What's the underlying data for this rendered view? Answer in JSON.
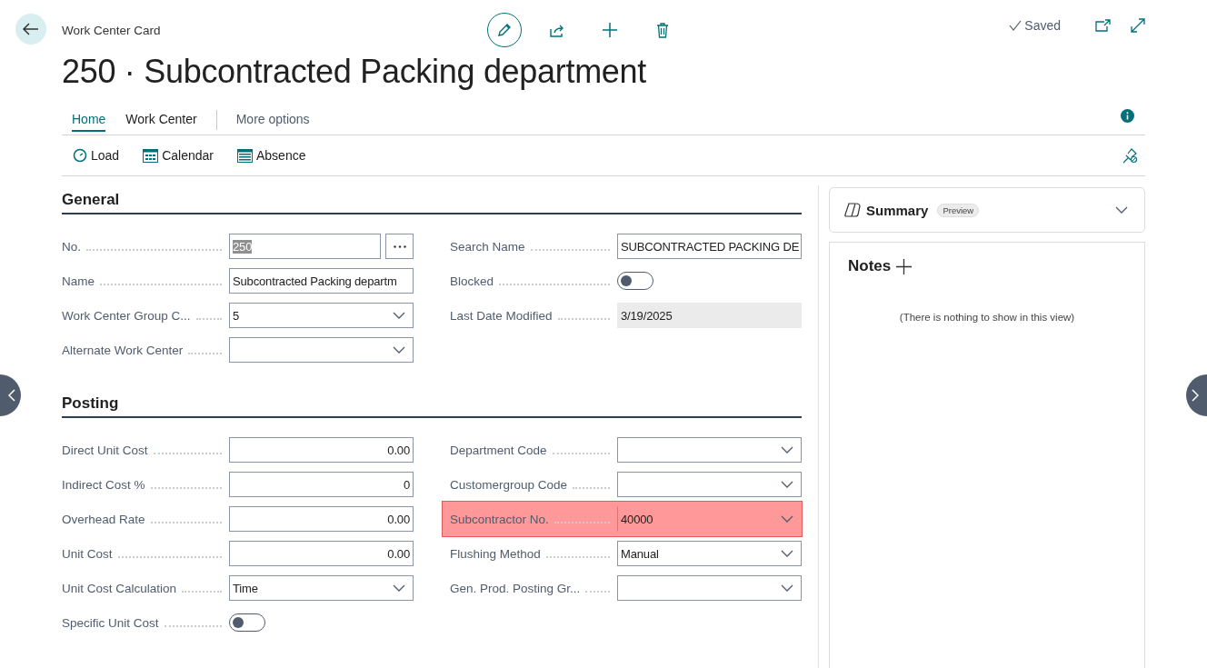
{
  "header": {
    "breadcrumb": "Work Center Card",
    "title": "250 · Subcontracted Packing department",
    "status": "Saved"
  },
  "tabs": [
    {
      "label": "Home",
      "selected": true
    },
    {
      "label": "Work Center",
      "selected": false
    },
    {
      "label": "More options",
      "selected": false
    }
  ],
  "actions": [
    {
      "label": "Load",
      "kind": "load"
    },
    {
      "label": "Calendar",
      "kind": "calendar"
    },
    {
      "label": "Absence",
      "kind": "absence"
    }
  ],
  "sections": [
    {
      "title": "General",
      "columns": [
        [
          {
            "label": "No.",
            "kind": "lookup",
            "value": "250",
            "text_selected": true
          },
          {
            "label": "Name",
            "kind": "text",
            "value": "Subcontracted Packing departm"
          },
          {
            "label": "Work Center Group C...",
            "kind": "dropdown",
            "value": "5"
          },
          {
            "label": "Alternate Work Center",
            "kind": "dropdown"
          }
        ],
        [
          {
            "label": "Search Name",
            "kind": "text",
            "value": "SUBCONTRACTED PACKING DE"
          },
          {
            "label": "Blocked",
            "kind": "toggle",
            "on": false
          },
          {
            "label": "Last Date Modified",
            "kind": "readonly",
            "value": "3/19/2025"
          }
        ]
      ]
    },
    {
      "title": "Posting",
      "columns": [
        [
          {
            "label": "Direct Unit Cost",
            "kind": "number",
            "value": "0.00"
          },
          {
            "label": "Indirect Cost %",
            "kind": "number",
            "value": "0"
          },
          {
            "label": "Overhead Rate",
            "kind": "number",
            "value": "0.00"
          },
          {
            "label": "Unit Cost",
            "kind": "number",
            "value": "0.00"
          },
          {
            "label": "Unit Cost Calculation",
            "kind": "dropdown",
            "value": "Time"
          },
          {
            "label": "Specific Unit Cost",
            "kind": "toggle",
            "on": false
          }
        ],
        [
          {
            "label": "Department Code",
            "kind": "dropdown"
          },
          {
            "label": "Customergroup Code",
            "kind": "dropdown"
          },
          {
            "label": "Subcontractor No.",
            "kind": "dropdown",
            "value": "40000",
            "highlighted": true
          },
          {
            "label": "Flushing Method",
            "kind": "dropdown",
            "value": "Manual"
          },
          {
            "label": "Gen. Prod. Posting Gr...",
            "kind": "dropdown"
          }
        ]
      ]
    }
  ],
  "summary": {
    "title": "Summary",
    "badge": "Preview"
  },
  "notes": {
    "title": "Notes",
    "empty_text": "(There is nothing to show in this view)"
  }
}
